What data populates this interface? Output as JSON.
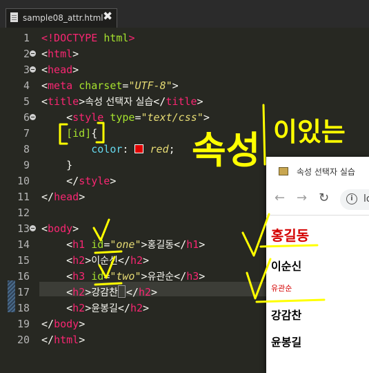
{
  "tab": {
    "title": "sample08_attr.html",
    "close_glyph": "✖"
  },
  "editor": {
    "line_numbers": [
      "1",
      "2",
      "3",
      "4",
      "5",
      "6",
      "7",
      "8",
      "9",
      "10",
      "11",
      "12",
      "13",
      "14",
      "15",
      "16",
      "17",
      "18",
      "19",
      "20"
    ],
    "lines": {
      "l1": {
        "open": "<!DOCTYPE ",
        "kw": "html",
        "close": ">"
      },
      "l2": {
        "lt": "<",
        "tag": "html",
        "gt": ">"
      },
      "l3": {
        "lt": "<",
        "tag": "head",
        "gt": ">"
      },
      "l4": {
        "lt": "<",
        "tag": "meta",
        "attr": "charset",
        "eq": "=",
        "val": "\"UTF-8\"",
        "gt": ">"
      },
      "l5": {
        "lt": "<",
        "tag": "title",
        "gt": ">",
        "text": "속성 선택자 실습",
        "lt2": "</",
        "tag2": "title",
        "gt2": ">"
      },
      "l6": {
        "indent": "    ",
        "lt": "<",
        "tag": "style",
        "attr": "type",
        "eq": "=",
        "val": "\"text/css\"",
        "gt": ">"
      },
      "l7": {
        "indent": "    ",
        "selector": "[id]",
        "brace": "{"
      },
      "l8": {
        "indent": "        ",
        "prop": "color",
        "colon": ": ",
        "val": "red",
        "semi": ";"
      },
      "l9": {
        "indent": "    ",
        "brace": "}"
      },
      "l10": {
        "indent": "    ",
        "lt": "</",
        "tag": "style",
        "gt": ">"
      },
      "l11": {
        "lt": "</",
        "tag": "head",
        "gt": ">"
      },
      "l13": {
        "lt": "<",
        "tag": "body",
        "gt": ">"
      },
      "l14": {
        "indent": "    ",
        "lt": "<",
        "tag": "h1",
        "attr": "id",
        "eq": "=",
        "val": "\"one\"",
        "gt": ">",
        "text": "홍길동",
        "lt2": "</",
        "tag2": "h1",
        "gt2": ">"
      },
      "l15": {
        "indent": "    ",
        "lt": "<",
        "tag": "h2",
        "gt": ">",
        "text": "이순신",
        "lt2": "</",
        "tag2": "h2",
        "gt2": ">"
      },
      "l16": {
        "indent": "    ",
        "lt": "<",
        "tag": "h3",
        "attr": "id",
        "eq": "=",
        "val": "\"two\"",
        "gt": ">",
        "text": "유관순",
        "lt2": "</",
        "tag2": "h3",
        "gt2": ">"
      },
      "l17": {
        "indent": "    ",
        "lt": "<",
        "tag": "h2",
        "gt": ">",
        "text": "강감찬",
        "lt2": "</",
        "tag2": "h2",
        "gt2": ">"
      },
      "l18": {
        "indent": "    ",
        "lt": "<",
        "tag": "h2",
        "gt": ">",
        "text": "윤봉길",
        "lt2": "</",
        "tag2": "h2",
        "gt2": ">"
      },
      "l19": {
        "lt": "</",
        "tag": "body",
        "gt": ">"
      },
      "l20": {
        "lt": "</",
        "tag": "html",
        "gt": ">"
      }
    }
  },
  "browser": {
    "tab_title": "속성 선택자 실습",
    "nav": {
      "back": "←",
      "forward": "→",
      "reload": "↻",
      "info": "i",
      "address": "lo"
    },
    "page": {
      "h1": "홍길동",
      "h2a": "이순신",
      "h3": "유관순",
      "h2b": "강감찬",
      "h2c": "윤봉길"
    }
  },
  "annotation": {
    "text": "속성",
    "text2": "이있는"
  },
  "colors": {
    "keyword": "#f92672",
    "attribute": "#a6e22e",
    "string": "#e6db74",
    "property": "#66d9ef",
    "highlight": "#ffff00",
    "page_red": "#d40000"
  }
}
